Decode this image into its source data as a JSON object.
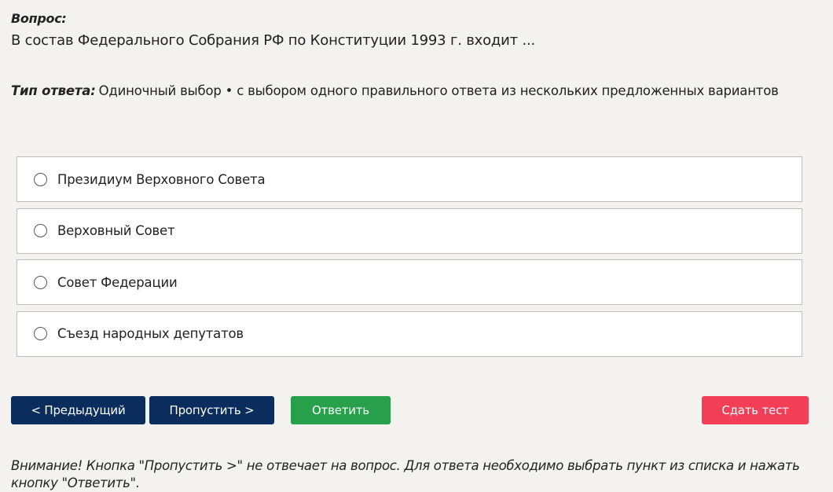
{
  "question": {
    "label": "Вопрос:",
    "text": "В состав Федерального Собрания РФ по Конституции 1993 г. входит ..."
  },
  "answer_type": {
    "label": "Тип ответа:",
    "value": "Одиночный выбор • с выбором одного правильного ответа из нескольких предложенных вариантов"
  },
  "options": [
    {
      "label": "Президиум Верховного Совета",
      "selected": false
    },
    {
      "label": "Верховный Совет",
      "selected": false
    },
    {
      "label": "Совет Федерации",
      "selected": false
    },
    {
      "label": "Съезд народных депутатов",
      "selected": false
    }
  ],
  "buttons": {
    "prev": "< Предыдущий",
    "skip": "Пропустить >",
    "answer": "Ответить",
    "submit": "Сдать тест"
  },
  "notice": "Внимание! Кнопка \"Пропустить >\" не отвечает на вопрос. Для ответа необходимо выбрать пункт из списка и нажать кнопку \"Ответить\".",
  "colors": {
    "background": "#f3f2ef",
    "nav_button": "#0a2d5e",
    "answer_button": "#28a04b",
    "submit_button": "#f23f57"
  }
}
